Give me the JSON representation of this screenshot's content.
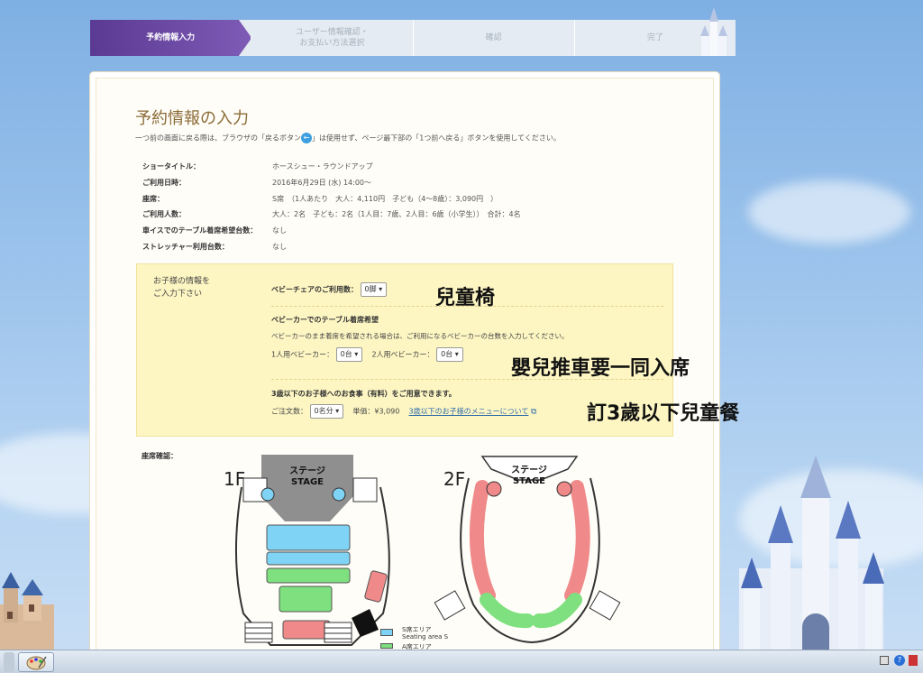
{
  "steps": [
    {
      "label": "予約情報入力"
    },
    {
      "line1": "ユーザー情報確認・",
      "line2": "お支払い方法選択"
    },
    {
      "label": "確認"
    },
    {
      "label": "完了"
    }
  ],
  "page": {
    "title": "予約情報の入力",
    "notice_pre": "一つ前の画面に戻る際は、ブラウザの「戻るボタン",
    "notice_post": "」は使用せず、ページ最下部の「1つ前へ戻る」ボタンを使用してください。"
  },
  "info": [
    {
      "key": "ショータイトル：",
      "value": "ホースシュー・ラウンドアップ"
    },
    {
      "key": "ご利用日時：",
      "value": "2016年6月29日 (水) 14:00〜"
    },
    {
      "key": "座席：",
      "value": "S席　（1人あたり　大人：4,110円　子ども（4〜8歳）：3,090円　）"
    },
    {
      "key": "ご利用人数：",
      "value": "大人：2名　子ども：2名（1人目：7歳、2人目：6歳（小学生））　合計：4名"
    },
    {
      "key": "車イスでのテーブル着席希望台数：",
      "value": "なし"
    },
    {
      "key": "ストレッチャー利用台数：",
      "value": "なし"
    }
  ],
  "children": {
    "label_line1": "お子様の情報を",
    "label_line2": "ご入力下さい",
    "babychair_label": "ベビーチェアのご利用数：",
    "babychair_value": "0脚",
    "stroller_title": "ベビーカーでのテーブル着席希望",
    "stroller_desc": "ベビーカーのまま着席を希望される場合は、ご利用になるベビーカーの台数を入力してください。",
    "stroller1_label": "1人用ベビーカー：",
    "stroller1_value": "0台",
    "stroller2_label": "2人用ベビーカー：",
    "stroller2_value": "0台",
    "meal_title": "3歳以下のお子様へのお食事（有料）をご用意できます。",
    "meal_count_label": "ご注文数：",
    "meal_count_value": "0名分",
    "meal_price": "単価：¥3,090",
    "meal_link": "3歳以下のお子様のメニューについて"
  },
  "annotations": {
    "a1": "兒童椅",
    "a2": "嬰兒推車要一同入席",
    "a3": "訂3歲以下兒童餐"
  },
  "seating": {
    "label": "座席確認：",
    "floor1": "1F",
    "floor2": "2F",
    "stage_jp": "ステージ",
    "stage_en": "STAGE",
    "legend_s_jp": "S席エリア",
    "legend_s_en": "Seating area S",
    "legend_a_jp": "A席エリア"
  },
  "colors": {
    "seat_s": "#7fd3f5",
    "seat_a": "#7ee07e",
    "seat_b": "#f08a8a",
    "step_active": "#6a4aa5",
    "yellow_box": "#fdf6c3"
  }
}
